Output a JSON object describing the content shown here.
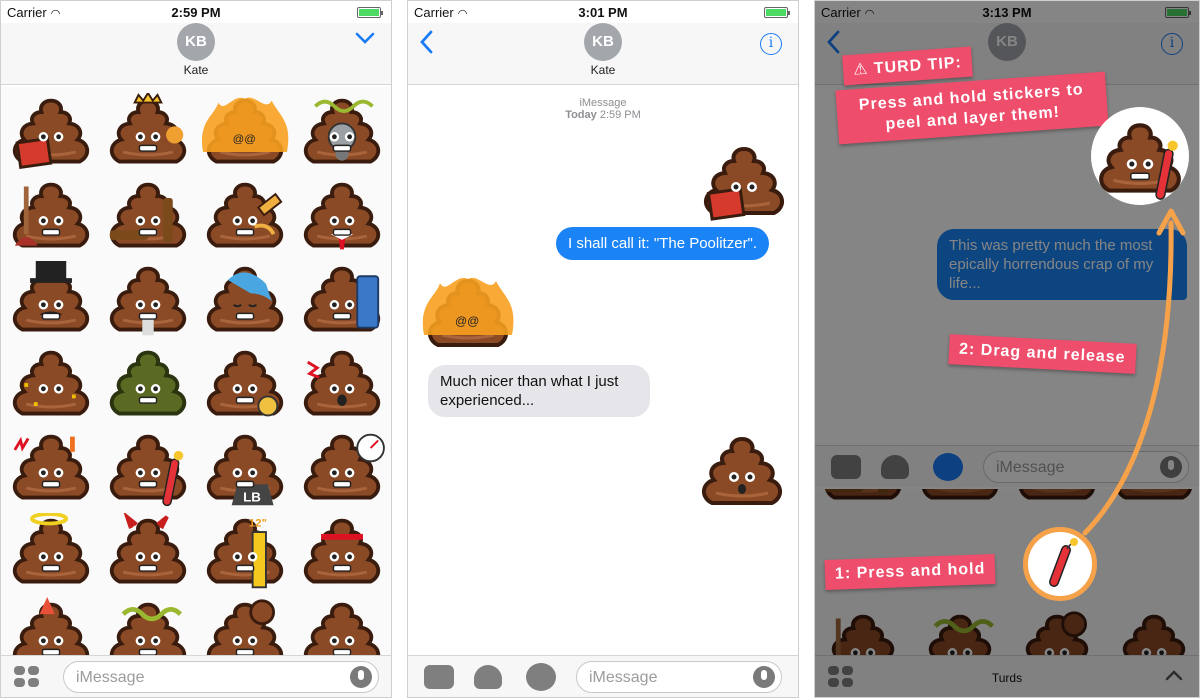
{
  "screens": [
    {
      "status": {
        "carrier": "Carrier",
        "time": "2:59 PM"
      },
      "contact": {
        "initials": "KB",
        "name": "Kate"
      },
      "input": {
        "placeholder": "iMessage"
      },
      "stickers": [
        "reading-poo",
        "crowned-poo",
        "flaming-poo",
        "gasmask-poo",
        "plunger-poo",
        "bottle-poo",
        "paperclip-poo",
        "necktie-poo",
        "tophat-poo",
        "flashlight-poo",
        "sleeping-poo",
        "porta-potty-poo",
        "confetti-poo",
        "green-poo",
        "alarm-clock-poo",
        "exploding-poo",
        "angry-poo",
        "dynamite-poo",
        "weight-poo",
        "speedometer-poo",
        "halo-poo",
        "devil-poo",
        "ruler-poo",
        "headband-poo",
        "party-poo",
        "stink-poo",
        "twin-poo",
        "small-poo"
      ],
      "badges": {
        "weight": "LB",
        "ruler": "12\""
      }
    },
    {
      "status": {
        "carrier": "Carrier",
        "time": "3:01 PM"
      },
      "contact": {
        "initials": "KB",
        "name": "Kate"
      },
      "timestamp": {
        "service": "iMessage",
        "day": "Today",
        "time": "2:59 PM"
      },
      "messages": [
        {
          "type": "sticker",
          "direction": "out",
          "sticker": "reading-poo"
        },
        {
          "type": "text",
          "direction": "out",
          "text": "I shall call it: \"The Poolitzer\"."
        },
        {
          "type": "sticker",
          "direction": "in",
          "sticker": "flaming-poo"
        },
        {
          "type": "text",
          "direction": "in",
          "text": "Much nicer than what I just experienced..."
        },
        {
          "type": "sticker",
          "direction": "out",
          "sticker": "plain-poo"
        }
      ],
      "input": {
        "placeholder": "iMessage"
      }
    },
    {
      "status": {
        "carrier": "Carrier",
        "time": "3:13 PM"
      },
      "contact": {
        "initials": "KB"
      },
      "tip_title": "TURD TIP:",
      "tip_body": "Press and hold stickers to peel and layer them!",
      "message": "This was pretty much the most epically horrendous crap of my life...",
      "step1": "1: Press and hold",
      "step2": "2: Drag and release",
      "input": {
        "placeholder": "iMessage"
      },
      "tray_label": "Turds"
    }
  ],
  "colors": {
    "accent": "#1a7cf5",
    "bubble_out": "#1a84f6",
    "tip": "#ee4d6b",
    "ring": "#f6a24a",
    "poo": "#8b4a26"
  }
}
